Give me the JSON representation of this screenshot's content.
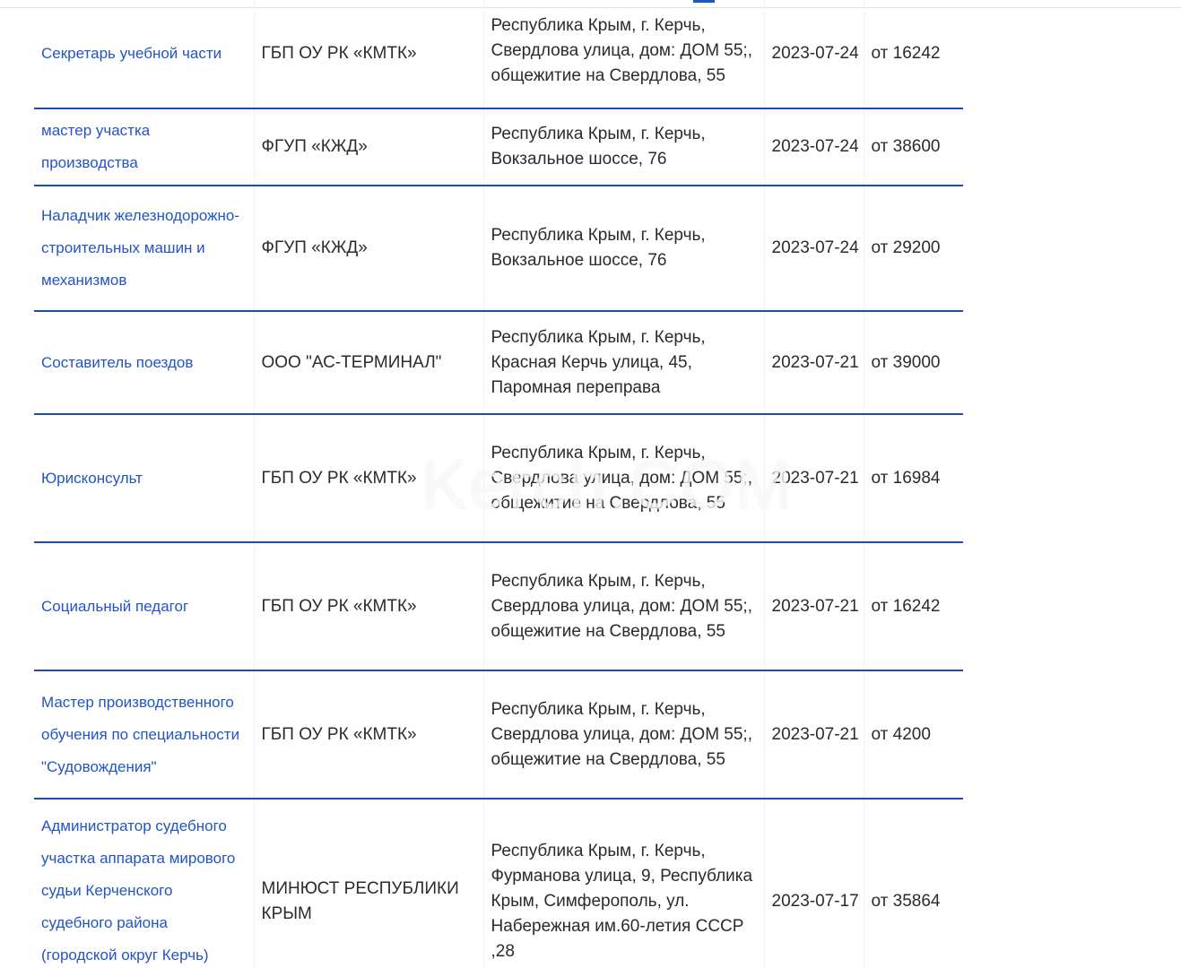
{
  "vacancies": [
    {
      "title": "Секретарь учебной части",
      "org": "ГБП ОУ РК «КМТК»",
      "address": "Республика Крым, г. Керчь, Свердлова улица, дом: ДОМ 55;, общежитие на Свердлова, 55",
      "date": "2023-07-24",
      "salary": "от 16242"
    },
    {
      "title": "мастер участка производства",
      "org": "ФГУП «КЖД»",
      "address": "Республика Крым, г. Керчь, Вокзальное шоссе, 76",
      "date": "2023-07-24",
      "salary": "от 38600"
    },
    {
      "title": "Наладчик железнодорожно-строительных машин и механизмов",
      "org": "ФГУП «КЖД»",
      "address": "Республика Крым, г. Керчь, Вокзальное шоссе, 76",
      "date": "2023-07-24",
      "salary": "от 29200"
    },
    {
      "title": "Составитель поездов",
      "org": "ООО \"АС-ТЕРМИНАЛ\"",
      "address": "Республика Крым, г. Керчь, Красная Керчь улица, 45, Паромная переправа",
      "date": "2023-07-21",
      "salary": "от 39000"
    },
    {
      "title": "Юрисконсульт",
      "org": "ГБП ОУ РК «КМТК»",
      "address": "Республика Крым, г. Керчь, Свердлова улица, дом: ДОМ 55;, общежитие на Свердлова, 55",
      "date": "2023-07-21",
      "salary": "от 16984"
    },
    {
      "title": "Социальный педагог",
      "org": "ГБП ОУ РК «КМТК»",
      "address": "Республика Крым, г. Керчь, Свердлова улица, дом: ДОМ 55;, общежитие на Свердлова, 55",
      "date": "2023-07-21",
      "salary": "от 16242"
    },
    {
      "title": "Мастер производственного обучения по специальности \"Судовождения\"",
      "org": "ГБП ОУ РК «КМТК»",
      "address": "Республика Крым, г. Керчь, Свердлова улица, дом: ДОМ 55;, общежитие на Свердлова, 55",
      "date": "2023-07-21",
      "salary": "от 4200"
    },
    {
      "title": "Администратор судебного участка аппарата мирового судьи Керченского судебного района (городской округ Керчь) Республики Крым",
      "org": "МИНЮСТ РЕСПУБЛИКИ КРЫМ",
      "address": "Республика Крым, г. Керчь, Фурманова улица, 9, Республика Крым, Симферополь, ул. Набережная им.60-летия СССР ,28",
      "date": "2023-07-17",
      "salary": "от 35864"
    }
  ],
  "watermark": "Kerch.COM"
}
